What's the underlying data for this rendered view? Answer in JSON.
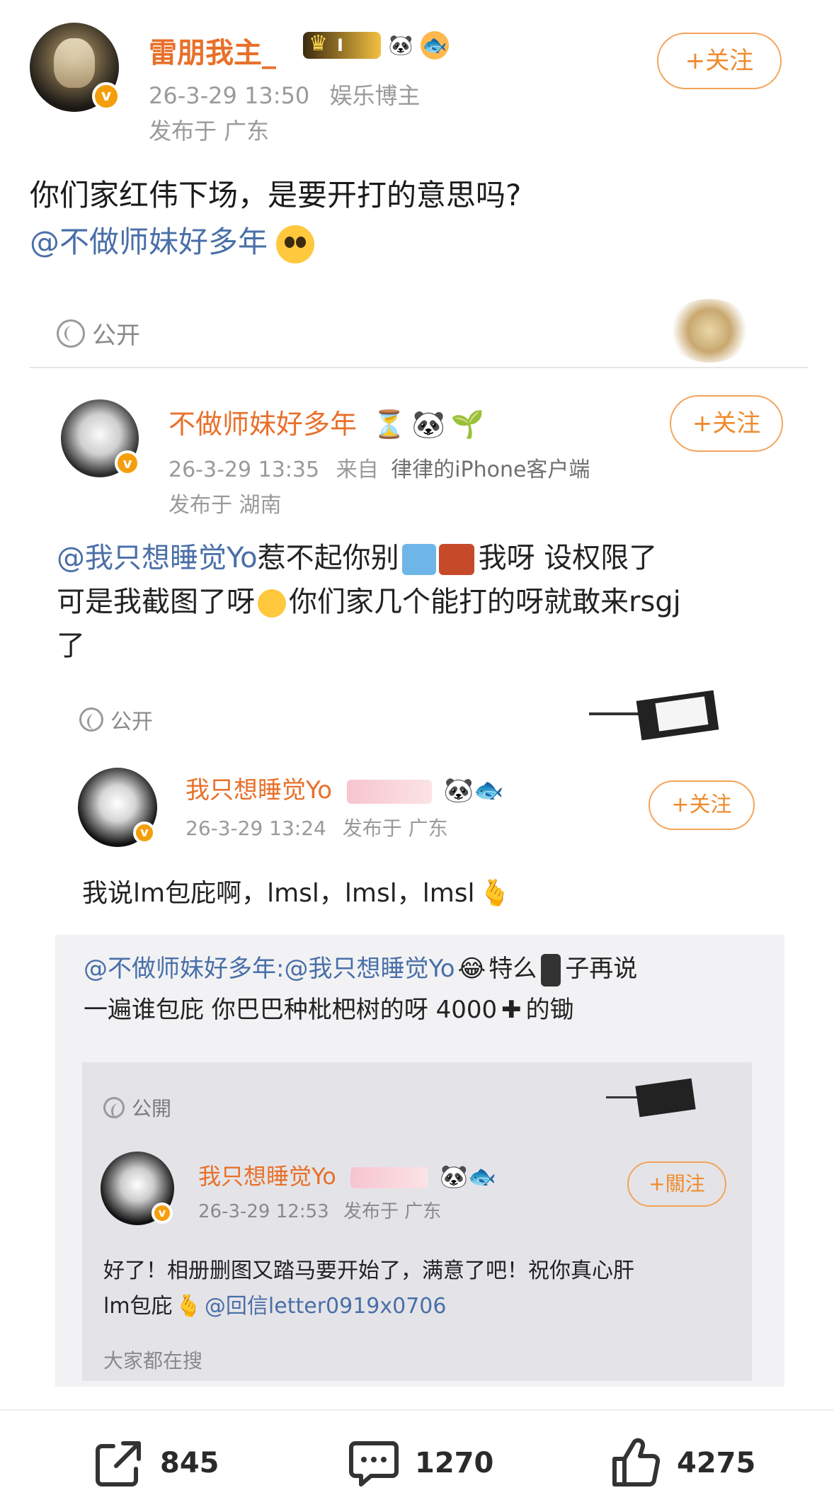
{
  "author": {
    "name": "雷朋我主_",
    "level_badge": "I",
    "timestamp": "26-3-29 13:50",
    "role": "娱乐博主",
    "location": "发布于 广东",
    "follow_label": "+关注"
  },
  "post": {
    "text": "你们家红伟下场，是要开打的意思吗?",
    "mention": "@不做师妹好多年"
  },
  "shot1": {
    "visibility": "公开",
    "name": "不做师妹好多年",
    "timestamp": "26-3-29 13:35",
    "source_prefix": "来自",
    "source": "律律的iPhone客户端",
    "location": "发布于 湖南",
    "follow_label": "+关注",
    "line1_mention": "@我只想睡觉Yo",
    "line1_a": "惹不起你别",
    "line1_b": "我呀 设权限了",
    "line2_a": "可是我截图了呀",
    "line2_b": "你们家几个能打的呀就敢来rsgj",
    "line3": "了"
  },
  "shot2": {
    "visibility": "公开",
    "name": "我只想睡觉Yo",
    "timestamp": "26-3-29 13:24",
    "location": "发布于 广东",
    "follow_label": "+关注",
    "text": "我说lm包庇啊，lmsl，lmsl，lmsl"
  },
  "repost": {
    "mention": "@不做师妹好多年:@我只想睡觉Yo",
    "text_a": "特么",
    "text_b": "子再说",
    "line2": "一遍谁包庇 你巴巴种枇杷树的呀 4000",
    "line2_b": "的锄"
  },
  "shot3": {
    "visibility": "公開",
    "name": "我只想睡觉Yo",
    "timestamp": "26-3-29 12:53",
    "location": "发布于 广东",
    "follow_label": "+關注",
    "line1": "好了！相册删图又踏马要开始了，满意了吧！祝你真心肝",
    "line2_a": "lm包庇",
    "line2_mention": "@回信letter0919x0706",
    "footer": "大家都在搜"
  },
  "actions": {
    "repost_count": "845",
    "comment_count": "1270",
    "like_count": "4275"
  },
  "colors": {
    "name_orange": "#e8702a",
    "mention_blue": "#4a6fa8",
    "meta_grey": "#9a9a9a",
    "follow_border": "#f4a35a"
  },
  "icons": [
    "verified-v-icon",
    "level-badge-icon",
    "panda-icon",
    "fish-icon",
    "pleading-face-icon",
    "globe-icon",
    "share-icon",
    "comment-icon",
    "like-icon"
  ]
}
